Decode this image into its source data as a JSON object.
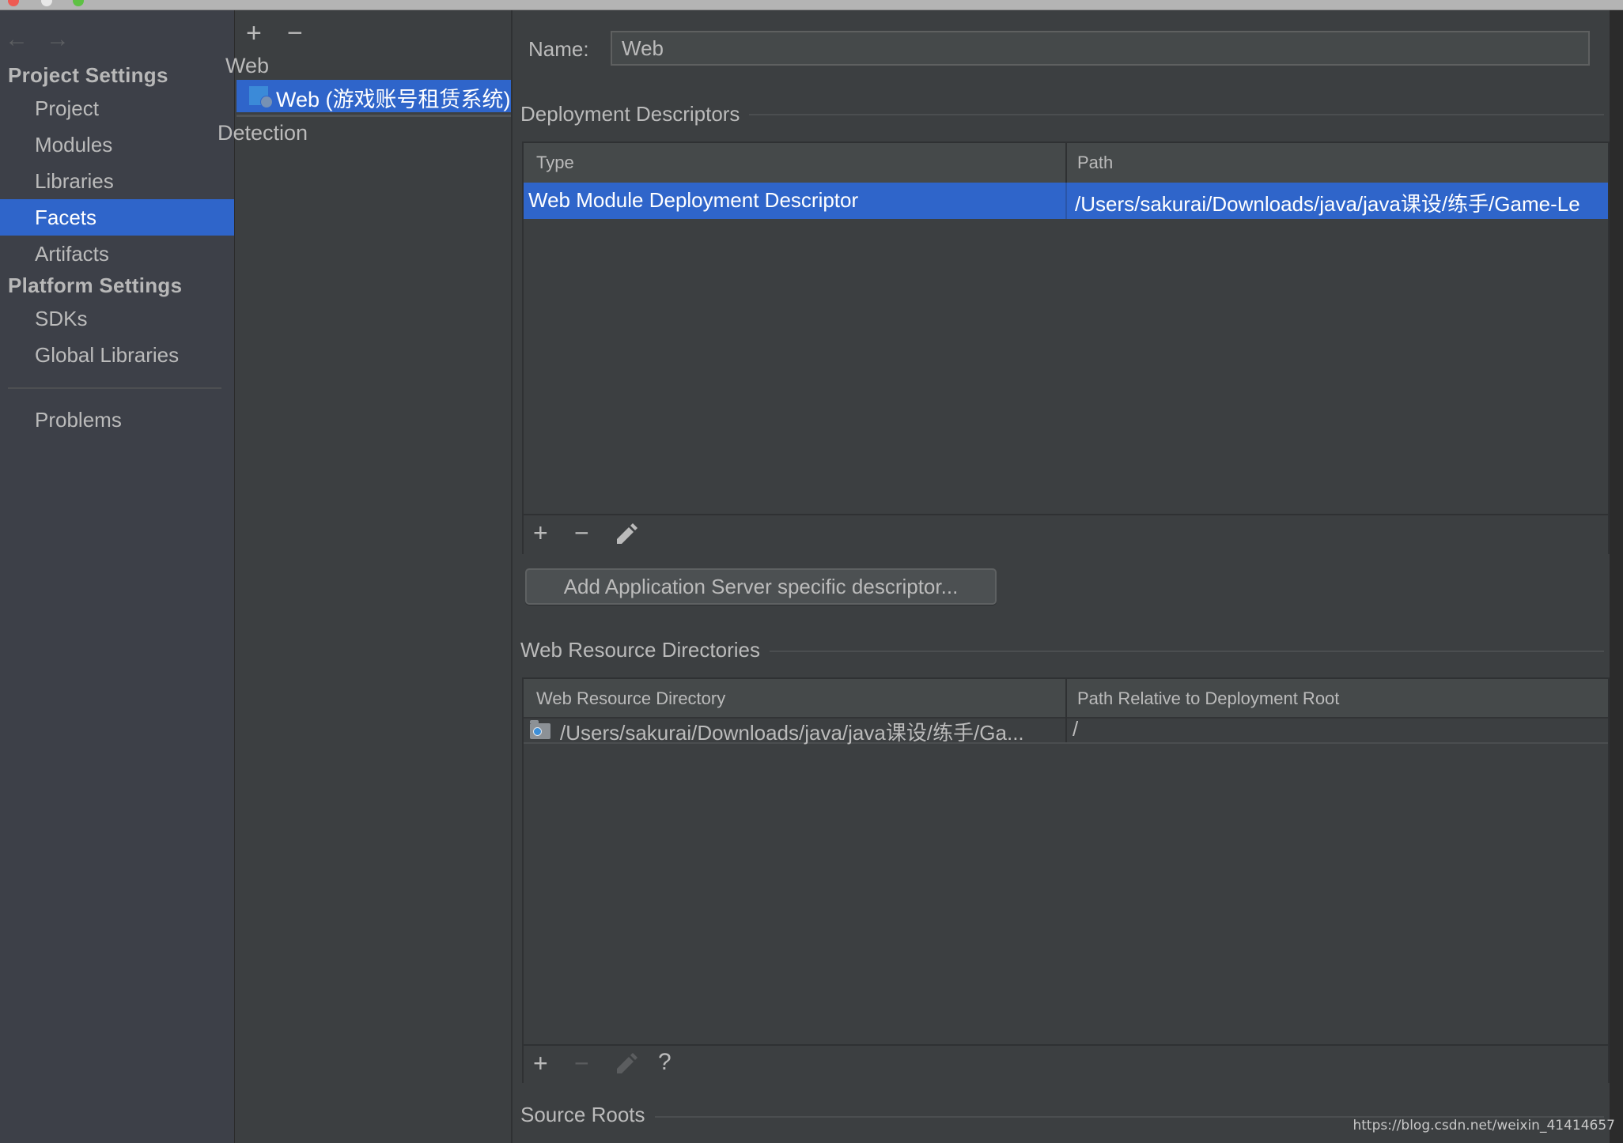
{
  "window": {
    "traffic_lights": [
      "close",
      "minimize",
      "zoom"
    ]
  },
  "sidebar": {
    "nav": {
      "back_icon": "arrow-left-icon",
      "forward_icon": "arrow-right-icon"
    },
    "sections": [
      {
        "title": "Project Settings",
        "items": [
          {
            "label": "Project",
            "selected": false
          },
          {
            "label": "Modules",
            "selected": false
          },
          {
            "label": "Libraries",
            "selected": false
          },
          {
            "label": "Facets",
            "selected": true
          },
          {
            "label": "Artifacts",
            "selected": false
          }
        ]
      },
      {
        "title": "Platform Settings",
        "items": [
          {
            "label": "SDKs",
            "selected": false
          },
          {
            "label": "Global Libraries",
            "selected": false
          }
        ]
      }
    ],
    "extra_items": [
      {
        "label": "Problems"
      }
    ]
  },
  "tree": {
    "toolbar": {
      "add": "+",
      "remove": "−"
    },
    "group_label": "Web",
    "selected_item": "Web (游戏账号租赁系统)",
    "detection_label": "Detection"
  },
  "content": {
    "name_label": "Name:",
    "name_value": "Web",
    "deployment_descriptors": {
      "title": "Deployment Descriptors",
      "columns": [
        "Type",
        "Path"
      ],
      "rows": [
        {
          "type": "Web Module Deployment Descriptor",
          "path": "/Users/sakurai/Downloads/java/java课设/练手/Game-Le",
          "selected": true
        }
      ],
      "toolbar": {
        "add": "+",
        "remove": "−",
        "edit_icon": "pencil-icon"
      }
    },
    "add_server_descriptor_button": "Add Application Server specific descriptor...",
    "web_resource_directories": {
      "title": "Web Resource Directories",
      "columns": [
        "Web Resource Directory",
        "Path Relative to Deployment Root"
      ],
      "rows": [
        {
          "directory": "/Users/sakurai/Downloads/java/java课设/练手/Ga...",
          "relative_path": "/"
        }
      ],
      "toolbar": {
        "add": "+",
        "remove": "−",
        "edit_icon": "pencil-icon",
        "help": "?"
      }
    },
    "source_roots": {
      "title": "Source Roots"
    }
  },
  "watermark": "https://blog.csdn.net/weixin_41414657",
  "colors": {
    "selection": "#2f65ca",
    "background": "#3c3f41",
    "sidebar_bg": "#3d4048",
    "text": "#bbbbbb"
  }
}
